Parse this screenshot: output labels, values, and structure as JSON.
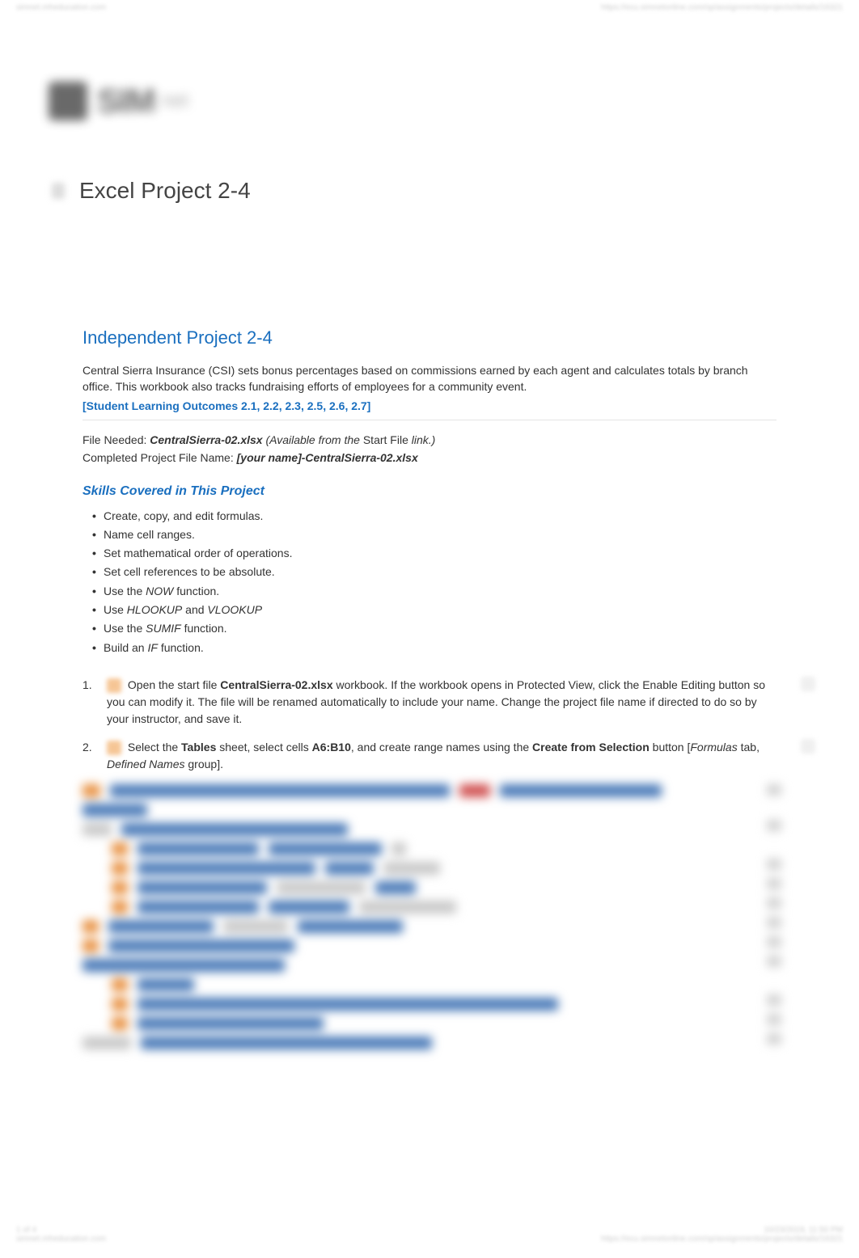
{
  "header": {
    "left_small": "simnet.mheducation.com",
    "right_small": "https://ecu.simnetonline.com/sp/assignments/projects/details/16321"
  },
  "logo": {
    "main": "SIM",
    "suffix": "net"
  },
  "doc_title": "Excel Project 2-4",
  "project": {
    "heading": "Independent Project 2-4",
    "intro": "Central Sierra Insurance (CSI) sets bonus percentages based on commissions earned by each agent and calculates totals by branch office. This workbook also tracks fundraising efforts of employees for a community event.",
    "outcomes": "[Student Learning Outcomes 2.1, 2.2, 2.3, 2.5, 2.6, 2.7]",
    "file_needed_label": "File Needed:",
    "file_needed_name": "CentralSierra-02.xlsx",
    "file_needed_avail": "(Available from the ",
    "file_needed_start": "Start File",
    "file_needed_link": "link.)",
    "completed_label": "Completed Project File Name:",
    "completed_name": "[your name]-CentralSierra-02.xlsx",
    "skills_heading": "Skills Covered in This Project",
    "skills": [
      {
        "text": "Create, copy, and edit formulas."
      },
      {
        "text": "Name cell ranges."
      },
      {
        "text": "Set mathematical order of operations."
      },
      {
        "text": "Set cell references to be absolute."
      },
      {
        "prefix": "Use the ",
        "func": "NOW",
        "suffix": " function."
      },
      {
        "prefix": "Use ",
        "func": "HLOOKUP",
        "mid": " and ",
        "func2": "VLOOKUP"
      },
      {
        "prefix": "Use the ",
        "func": "SUMIF",
        "suffix": " function."
      },
      {
        "prefix": "Build an ",
        "func": "IF",
        "suffix": " function."
      }
    ],
    "steps": [
      {
        "pre": "Open the start file ",
        "bold1": "CentralSierra-02.xlsx",
        "post1": " workbook. If the workbook opens in Protected View, click the Enable Editing button so you can modify it. The file will be renamed automatically to include your name. Change the project file name if directed to do so by your instructor, and save it."
      },
      {
        "pre": "Select the ",
        "bold1": "Tables",
        "mid1": " sheet, select cells ",
        "bold2": "A6:B10",
        "mid2": ", and create range names using the ",
        "bold3": "Create from Selection",
        "mid3": " button [",
        "ital1": "Formulas",
        "mid4": " tab, ",
        "ital2": "Defined Names",
        "post": " group]."
      }
    ]
  },
  "footer": {
    "left1": "1 of 4",
    "left2": "simnet.mheducation.com",
    "right1": "10/23/2019, 11:50 PM",
    "right2": "https://ecu.simnetonline.com/sp/assignments/projects/details/16321"
  }
}
